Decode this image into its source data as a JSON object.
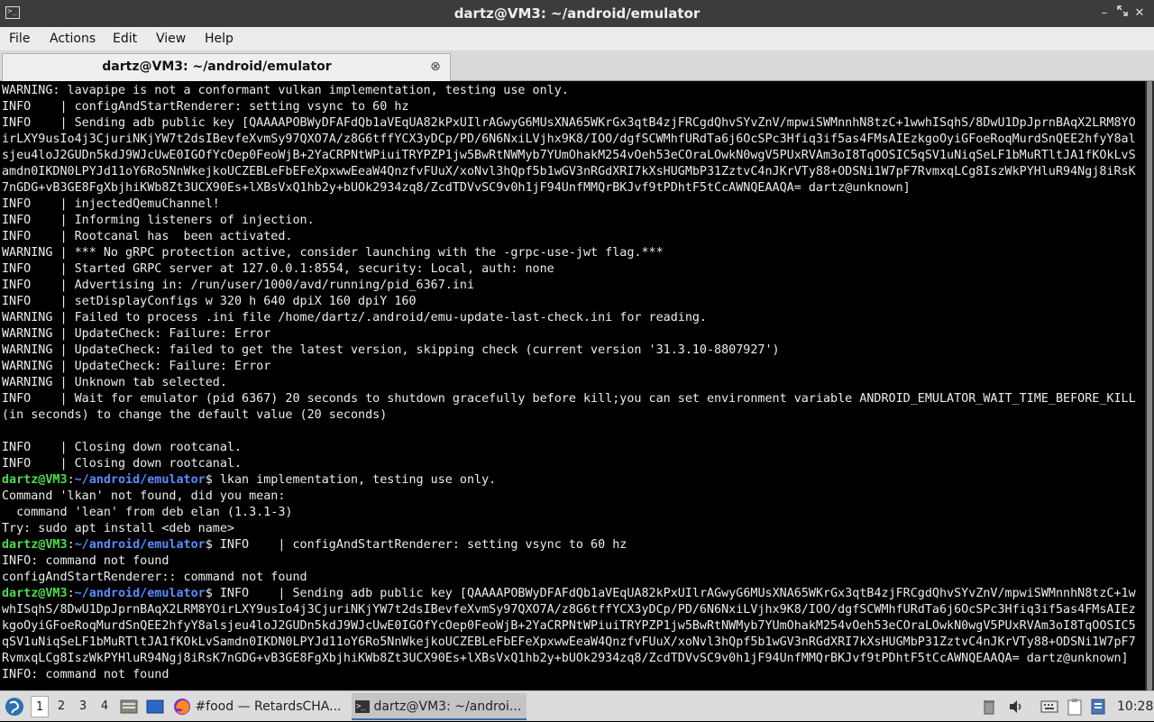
{
  "window": {
    "title": "dartz@VM3: ~/android/emulator",
    "app_icon": "terminal-icon",
    "controls": [
      "minimize-icon",
      "maximize-icon",
      "close-icon"
    ]
  },
  "menu": [
    "File",
    "Actions",
    "Edit",
    "View",
    "Help"
  ],
  "tab": {
    "label": "dartz@VM3: ~/android/emulator",
    "close_glyph": "⊗"
  },
  "terminal": {
    "colors": {
      "background": "#000000",
      "text": "#ececec",
      "prompt_user": "#4edc4e",
      "prompt_dir": "#5b8cff"
    },
    "lines": [
      {
        "text": "WARNING: lavapipe is not a conformant vulkan implementation, testing use only."
      },
      {
        "text": "INFO    | configAndStartRenderer: setting vsync to 60 hz"
      },
      {
        "text": "INFO    | Sending adb public key [QAAAAPOBWyDFAFdQb1aVEqUA82kPxUIlrAGwyG6MUsXNA65WKrGx3qtB4zjFRCgdQhvSYvZnV/mpwiSWMnnhN8tzC+1wwhISqhS/8DwU1DpJprnBAqX2LRM8YO"
      },
      {
        "text": "irLXY9usIo4j3CjuriNKjYW7t2dsIBevfeXvmSy97QXO7A/z8G6tffYCX3yDCp/PD/6N6NxiLVjhx9K8/IOO/dgfSCWMhfURdTa6j6OcSPc3Hfiq3if5as4FMsAIEzkgoOyiGFoeRoqMurdSnQEE2hfyY8al"
      },
      {
        "text": "sjeu4loJ2GUDn5kdJ9WJcUwE0IGOfYcOep0FeoWjB+2YaCRPNtWPiuiTRYPZP1jw5BwRtNWMyb7YUmOhakM254vOeh53eCOraLOwkN0wgV5PUxRVAm3oI8TqOOSIC5qSV1uNiqSeLF1bMuRTltJA1fKOkLvS"
      },
      {
        "text": "amdn0IKDN0LPYJd11oY6Ro5NnWkejkoUCZEBLeFbEFeXpxwwEeaW4QnzfvFUuX/xoNvl3hQpf5b1wGV3nRGdXRI7kXsHUGMbP31ZztvC4nJKrVTy88+ODSNi1W7pF7RvmxqLCg8IszWkPYHluR94Ngj8iRsK"
      },
      {
        "text": "7nGDG+vB3GE8FgXbjhiKWb8Zt3UCX90Es+lXBsVxQ1hb2y+bUOk2934zq8/ZcdTDVvSC9v0h1jF94UnfMMQrBKJvf9tPDhtF5tCcAWNQEAAQA= dartz@unknown]"
      },
      {
        "text": "INFO    | injectedQemuChannel!"
      },
      {
        "text": "INFO    | Informing listeners of injection."
      },
      {
        "text": "INFO    | Rootcanal has  been activated."
      },
      {
        "text": "WARNING | *** No gRPC protection active, consider launching with the -grpc-use-jwt flag.***"
      },
      {
        "text": "INFO    | Started GRPC server at 127.0.0.1:8554, security: Local, auth: none"
      },
      {
        "text": "INFO    | Advertising in: /run/user/1000/avd/running/pid_6367.ini"
      },
      {
        "text": "INFO    | setDisplayConfigs w 320 h 640 dpiX 160 dpiY 160"
      },
      {
        "text": "WARNING | Failed to process .ini file /home/dartz/.android/emu-update-last-check.ini for reading."
      },
      {
        "text": "WARNING | UpdateCheck: Failure: Error"
      },
      {
        "text": "WARNING | UpdateCheck: failed to get the latest version, skipping check (current version '31.3.10-8807927')"
      },
      {
        "text": "WARNING | UpdateCheck: Failure: Error"
      },
      {
        "text": "WARNING | Unknown tab selected."
      },
      {
        "text": "INFO    | Wait for emulator (pid 6367) 20 seconds to shutdown gracefully before kill;you can set environment variable ANDROID_EMULATOR_WAIT_TIME_BEFORE_KILL"
      },
      {
        "text": "(in seconds) to change the default value (20 seconds)"
      },
      {
        "text": ""
      },
      {
        "text": "INFO    | Closing down rootcanal."
      },
      {
        "text": "INFO    | Closing down rootcanal."
      },
      {
        "user": "dartz@VM3",
        "path": "~/android/emulator",
        "text": "$ lkan implementation, testing use only."
      },
      {
        "text": "Command 'lkan' not found, did you mean:"
      },
      {
        "text": "  command 'lean' from deb elan (1.3.1-3)"
      },
      {
        "text": "Try: sudo apt install <deb name>"
      },
      {
        "user": "dartz@VM3",
        "path": "~/android/emulator",
        "text": "$ INFO    | configAndStartRenderer: setting vsync to 60 hz"
      },
      {
        "text": "INFO: command not found"
      },
      {
        "text": "configAndStartRenderer:: command not found"
      },
      {
        "user": "dartz@VM3",
        "path": "~/android/emulator",
        "text": "$ INFO    | Sending adb public key [QAAAAPOBWyDFAFdQb1aVEqUA82kPxUIlrAGwyG6MUsXNA65WKrGx3qtB4zjFRCgdQhvSYvZnV/mpwiSWMnnhN8tzC+1w"
      },
      {
        "text": "whISqhS/8DwU1DpJprnBAqX2LRM8YOirLXY9usIo4j3CjuriNKjYW7t2dsIBevfeXvmSy97QXO7A/z8G6tffYCX3yDCp/PD/6N6NxiLVjhx9K8/IOO/dgfSCWMhfURdTa6j6OcSPc3Hfiq3if5as4FMsAIEz"
      },
      {
        "text": "kgoOyiGFoeRoqMurdSnQEE2hfyY8alsjeu4loJ2GUDn5kdJ9WJcUwE0IGOfYcOep0FeoWjB+2YaCRPNtWPiuiTRYPZP1jw5BwRtNWMyb7YUmOhakM254vOeh53eCOraLOwkN0wgV5PUxRVAm3oI8TqOOSIC5"
      },
      {
        "text": "qSV1uNiqSeLF1bMuRTltJA1fKOkLvSamdn0IKDN0LPYJd11oY6Ro5NnWkejkoUCZEBLeFbEFeXpxwwEeaW4QnzfvFUuX/xoNvl3hQpf5b1wGV3nRGdXRI7kXsHUGMbP31ZztvC4nJKrVTy88+ODSNi1W7pF7"
      },
      {
        "text": "RvmxqLCg8IszWkPYHluR94Ngj8iRsK7nGDG+vB3GE8FgXbjhiKWb8Zt3UCX90Es+lXBsVxQ1hb2y+bUOk2934zq8/ZcdTDVvSC9v0h1jF94UnfMMQrBKJvf9tPDhtF5tCcAWNQEAAQA= dartz@unknown]"
      },
      {
        "text": "INFO: command not found"
      }
    ]
  },
  "taskbar": {
    "start_icon": "app-menu-icon",
    "desktops": [
      "1",
      "2",
      "3",
      "4"
    ],
    "active_desktop": "1",
    "launchers": [
      "file-manager-icon",
      "show-desktop-icon"
    ],
    "tasks": [
      {
        "icon": "firefox-icon",
        "label": "#food — RetardsCHA..."
      },
      {
        "icon": "terminal-icon",
        "label": "dartz@VM3: ~/androi..."
      }
    ],
    "tray": [
      "trash-icon",
      "volume-icon",
      "keyboard-icon",
      "clipboard-icon",
      "update-notifier-icon"
    ],
    "clock": "10:28"
  }
}
